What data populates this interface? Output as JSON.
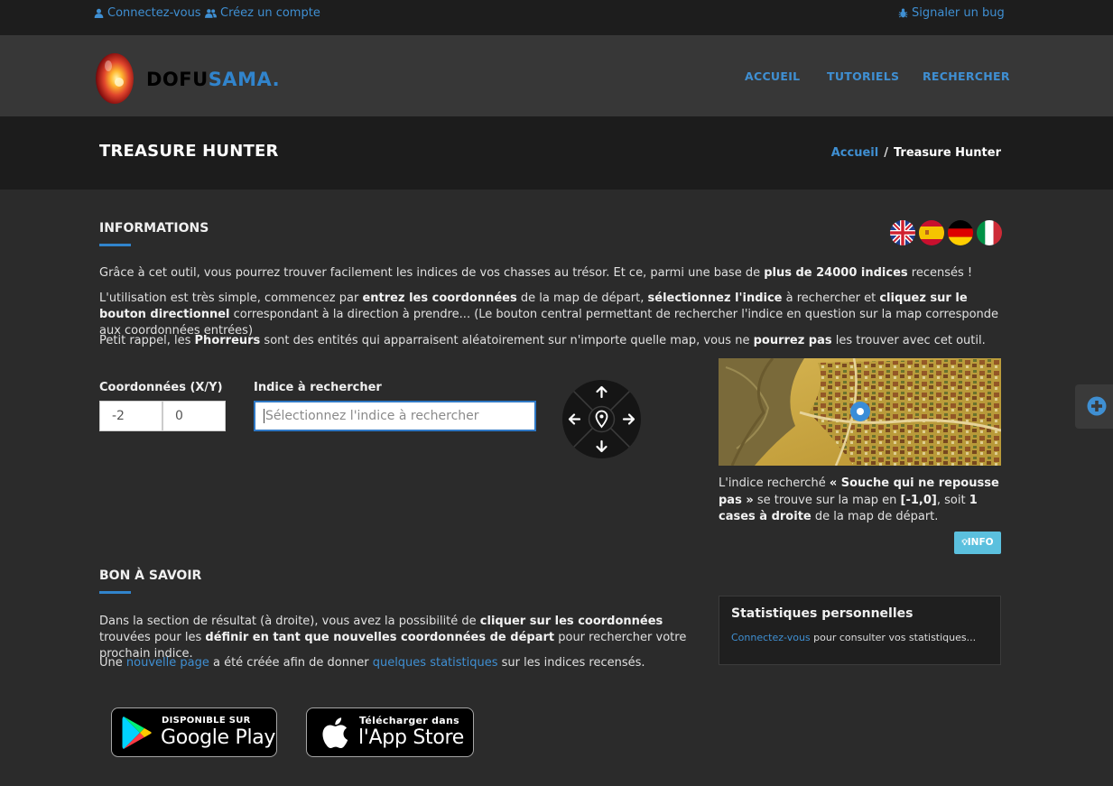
{
  "topbar": {
    "login": "Connectez-vous",
    "register": "Créez un compte",
    "report_bug": "Signaler un bug"
  },
  "brand": {
    "part1": "DOFU",
    "part2": "SAMA."
  },
  "nav": [
    "ACCUEIL",
    "TUTORIELS",
    "RECHERCHER"
  ],
  "page": {
    "title": "TREASURE HUNTER",
    "breadcrumb": {
      "home": "Accueil",
      "separator": "/",
      "current": "Treasure Hunter"
    }
  },
  "informations": {
    "heading": "INFORMATIONS",
    "p1_a": "Grâce à cet outil, vous pourrez trouver facilement les indices de vos chasses au trésor. Et ce, parmi une base de ",
    "p1_b": "plus de 24000 indices",
    "p1_c": " recensés !",
    "p2_a": "L'utilisation est très simple, commencez par ",
    "p2_b": "entrez les coordonnées",
    "p2_c": " de la map de départ, ",
    "p2_d": "sélectionnez l'indice",
    "p2_e": " à rechercher et ",
    "p2_f": "cliquez sur le bouton directionnel",
    "p2_g": " correspondant à la direction à prendre... (Le bouton central permettant de rechercher l'indice en question sur la map corresponde aux coordonnées entrées)",
    "p3_a": "Petit rappel, les ",
    "p3_b": "Phorreurs",
    "p3_c": " sont des entités qui apparraisent aléatoirement sur n'importe quelle map, vous ne ",
    "p3_d": "pourrez pas",
    "p3_e": " les trouver avec cet outil."
  },
  "flags": [
    "flag-uk-icon",
    "flag-spain-icon",
    "flag-germany-icon",
    "flag-italy-icon"
  ],
  "form": {
    "coords_label": "Coordonnées (X/Y)",
    "x": "-2",
    "y": "0",
    "clue_label": "Indice à rechercher",
    "clue_placeholder": "Sélectionnez l'indice à rechercher"
  },
  "result": {
    "t1": "L'indice recherché ",
    "clue": "« Souche qui ne repousse pas »",
    "t2": " se trouve sur la map en ",
    "coords": "[-1,0]",
    "t3": ", soit ",
    "distance": "1 cases à droite",
    "t4": " de la map de départ.",
    "info_button": "INFO"
  },
  "bon_a_savoir": {
    "heading": "BON À SAVOIR",
    "p1_a": "Dans la section de résultat (à droite), vous avez la possibilité de ",
    "p1_b": "cliquer sur les coordonnées",
    "p1_c": " trouvées pour les ",
    "p1_d": "définir en tant que nouvelles coordonnées de départ",
    "p1_e": " pour rechercher votre prochain indice.",
    "p2_a": "Une ",
    "p2_link1": "nouvelle page",
    "p2_b": " a été créée afin de donner ",
    "p2_link2": "quelques statistiques",
    "p2_c": " sur les indices recensés."
  },
  "stats": {
    "title": "Statistiques personnelles",
    "login_link": "Connectez-vous",
    "text": " pour consulter vos statistiques..."
  },
  "stores": {
    "google_small": "DISPONIBLE SUR",
    "google_big": "Google Play",
    "apple_small": "Télécharger dans",
    "apple_big": "l'App Store"
  },
  "colors": {
    "accent": "#3184cc",
    "info": "#5bc0de",
    "background": "#2b2b2b"
  }
}
